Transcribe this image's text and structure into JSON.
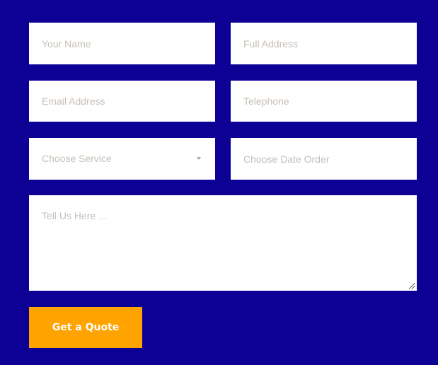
{
  "form": {
    "name_placeholder": "Your Name",
    "address_placeholder": "Full Address",
    "email_placeholder": "Email Address",
    "telephone_placeholder": "Telephone",
    "service_select_value": "Choose Service",
    "date_placeholder": "Choose Date Order",
    "message_placeholder": "Tell Us Here ...",
    "submit_label": "Get a Quote"
  },
  "icons": {
    "service_select": "chevron-down-icon",
    "message_textarea": "resize-handle-icon"
  },
  "colors": {
    "background": "#0c0095",
    "field_background": "#ffffff",
    "placeholder_text": "#c6bfb8",
    "button_background": "#ffa300",
    "button_text": "#ffffff"
  }
}
